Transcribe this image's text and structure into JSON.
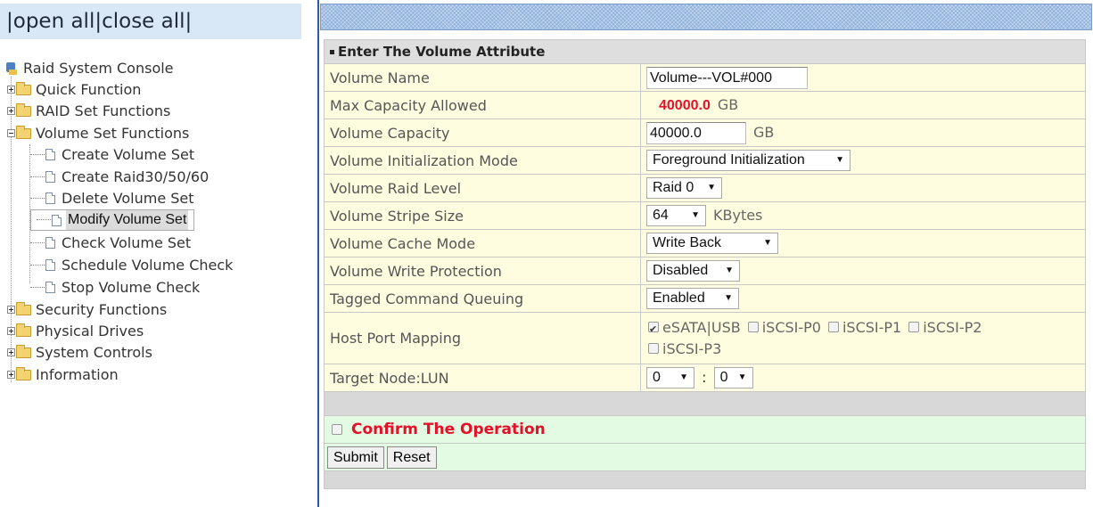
{
  "nav": {
    "open_all": "open all",
    "close_all": "close all",
    "sep": "|",
    "root": "Raid System Console",
    "items": [
      {
        "label": "Quick Function"
      },
      {
        "label": "RAID Set Functions"
      },
      {
        "label": "Volume Set Functions"
      },
      {
        "label": "Create Volume Set"
      },
      {
        "label": "Create Raid30/50/60"
      },
      {
        "label": "Delete Volume Set"
      },
      {
        "label": "Modify Volume Set"
      },
      {
        "label": "Check Volume Set"
      },
      {
        "label": "Schedule Volume Check"
      },
      {
        "label": "Stop Volume Check"
      },
      {
        "label": "Security Functions"
      },
      {
        "label": "Physical Drives"
      },
      {
        "label": "System Controls"
      },
      {
        "label": "Information"
      }
    ],
    "selected": "Modify Volume Set"
  },
  "form": {
    "header": "Enter The Volume Attribute",
    "rows": {
      "volume_name": {
        "label": "Volume Name",
        "value": "Volume---VOL#000"
      },
      "max_capacity": {
        "label": "Max Capacity Allowed",
        "value": "40000.0",
        "unit": "GB"
      },
      "volume_capacity": {
        "label": "Volume Capacity",
        "value": "40000.0",
        "unit": "GB"
      },
      "init_mode": {
        "label": "Volume Initialization Mode",
        "value": "Foreground Initialization"
      },
      "raid_level": {
        "label": "Volume Raid Level",
        "value": "Raid 0"
      },
      "stripe_size": {
        "label": "Volume Stripe Size",
        "value": "64",
        "unit": "KBytes"
      },
      "cache_mode": {
        "label": "Volume Cache Mode",
        "value": "Write Back"
      },
      "write_protection": {
        "label": "Volume Write Protection",
        "value": "Disabled"
      },
      "tcq": {
        "label": "Tagged Command Queuing",
        "value": "Enabled"
      },
      "host_port": {
        "label": "Host Port Mapping",
        "options": [
          {
            "label": "eSATA|USB",
            "checked": true
          },
          {
            "label": "iSCSI-P0",
            "checked": false
          },
          {
            "label": "iSCSI-P1",
            "checked": false
          },
          {
            "label": "iSCSI-P2",
            "checked": false
          },
          {
            "label": "iSCSI-P3",
            "checked": false
          }
        ]
      },
      "target_lun": {
        "label": "Target Node:LUN",
        "node": "0",
        "sep": ":",
        "lun": "0"
      }
    },
    "confirm": "Confirm The Operation",
    "submit": "Submit",
    "reset": "Reset"
  },
  "colors": {
    "accent_red": "#e4102a",
    "row_bg": "#fffde0",
    "confirm_bg": "#e2fbe2",
    "tree_header_bg": "#d9e8f7"
  }
}
